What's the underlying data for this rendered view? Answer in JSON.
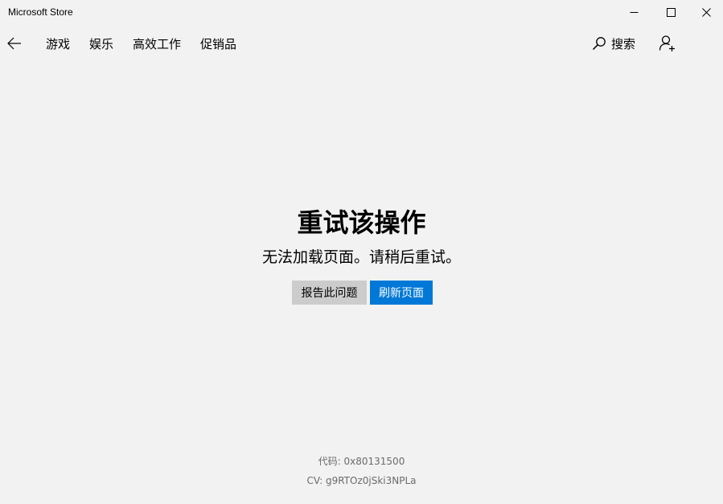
{
  "window": {
    "title": "Microsoft Store",
    "controls": [
      "minimize-icon",
      "maximize-icon",
      "close-icon"
    ]
  },
  "nav": {
    "back_icon": "back-arrow-icon",
    "items": [
      "游戏",
      "娱乐",
      "高效工作",
      "促销品"
    ],
    "search_label": "搜索",
    "search_icon": "search-icon",
    "account_icon": "add-user-icon"
  },
  "error": {
    "title": "重试该操作",
    "message": "无法加载页面。请稍后重试。",
    "report_button": "报告此问题",
    "refresh_button": "刷新页面",
    "code": "代码: 0x80131500",
    "cv": "CV: g9RTOz0jSki3NPLa"
  },
  "colors": {
    "background": "#f2f2f2",
    "accent": "#0078d7",
    "secondary_button": "#cccccc",
    "muted_text": "#6b6b6b"
  }
}
